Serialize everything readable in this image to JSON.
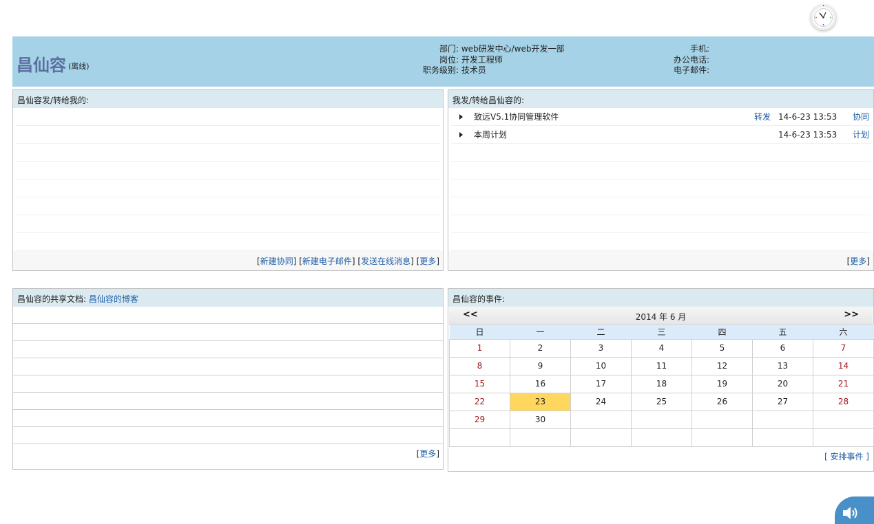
{
  "profile": {
    "name": "昌仙容",
    "status": "(离线)",
    "fields_left": [
      {
        "label": "部门:",
        "value": "web研发中心/web开发一部"
      },
      {
        "label": "岗位:",
        "value": "开发工程师"
      },
      {
        "label": "职务级别:",
        "value": "技术员"
      }
    ],
    "fields_right": [
      {
        "label": "手机:",
        "value": ""
      },
      {
        "label": "办公电话:",
        "value": ""
      },
      {
        "label": "电子邮件:",
        "value": ""
      }
    ]
  },
  "panel_sent_to_me": {
    "title": "昌仙容发/转给我的:",
    "links": [
      "新建协同",
      "新建电子邮件",
      "发送在线消息",
      "更多"
    ]
  },
  "panel_sent_by_me": {
    "title": "我发/转给昌仙容的:",
    "items": [
      {
        "subject": "致远V5.1协同管理软件",
        "action": "转发",
        "time": "14-6-23 13:53",
        "type": "协同"
      },
      {
        "subject": "本周计划",
        "action": "",
        "time": "14-6-23 13:53",
        "type": "计划"
      }
    ],
    "more": "更多"
  },
  "panel_docs": {
    "title": "昌仙容的共享文档:",
    "blog_link": "昌仙容的博客",
    "more": "更多"
  },
  "panel_events": {
    "title": "昌仙容的事件:",
    "prev": "<<",
    "next": ">>",
    "month_label": "2014 年 6 月",
    "weekdays": [
      "日",
      "一",
      "二",
      "三",
      "四",
      "五",
      "六"
    ],
    "weeks": [
      [
        "1",
        "2",
        "3",
        "4",
        "5",
        "6",
        "7"
      ],
      [
        "8",
        "9",
        "10",
        "11",
        "12",
        "13",
        "14"
      ],
      [
        "15",
        "16",
        "17",
        "18",
        "19",
        "20",
        "21"
      ],
      [
        "22",
        "23",
        "24",
        "25",
        "26",
        "27",
        "28"
      ],
      [
        "29",
        "30",
        "",
        "",
        "",
        "",
        ""
      ],
      [
        "",
        "",
        "",
        "",
        "",
        "",
        ""
      ]
    ],
    "today": "23",
    "arrange": "[ 安排事件 ]"
  },
  "colors": {
    "header_bg": "#a5d2e6",
    "name": "#5a6fa0",
    "link": "#1f5ea8",
    "weekend": "#a0161c",
    "today": "#ffd75e"
  },
  "icons": [
    "clock-icon",
    "speaker-icon",
    "arrow-right-icon"
  ]
}
